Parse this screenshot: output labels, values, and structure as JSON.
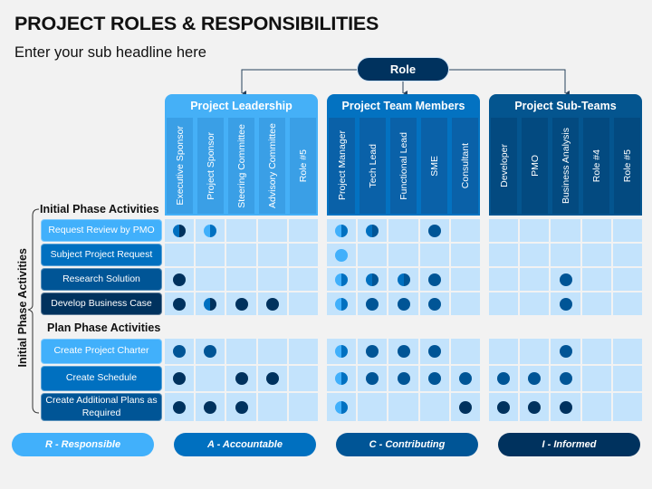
{
  "title": "PROJECT ROLES & RESPONSIBILITIES",
  "subtitle": "Enter your sub headline here",
  "role_label": "Role",
  "side_label": "Initial Phase Activities",
  "colors": {
    "R": "#41b0fb",
    "A": "#0070c0",
    "C": "#005596",
    "I": "#00325e"
  },
  "groups": [
    {
      "name": "Project Leadership",
      "columns": [
        "Executive Sponsor",
        "Project Sponsor",
        "Steering Committee",
        "Advisory Committee",
        "Role #5"
      ]
    },
    {
      "name": "Project Team Members",
      "columns": [
        "Project Manager",
        "Tech Lead",
        "Functional Lead",
        "SME",
        "Consultant"
      ]
    },
    {
      "name": "Project Sub-Teams",
      "columns": [
        "Developer",
        "PMO",
        "Business Analysis",
        "Role #4",
        "Role #5"
      ]
    }
  ],
  "sections": [
    {
      "title": "Initial Phase Activities",
      "rows": [
        {
          "label": "Request Review by PMO",
          "shade": "R",
          "cells": [
            "A/I",
            "R/A",
            "",
            "",
            "",
            "R/A",
            "A/C",
            "",
            "C",
            "",
            "",
            "",
            "",
            "",
            ""
          ]
        },
        {
          "label": "Subject Project Request",
          "shade": "A",
          "cells": [
            "",
            "",
            "",
            "",
            "",
            "R",
            "",
            "",
            "",
            "",
            "",
            "",
            "",
            "",
            ""
          ]
        },
        {
          "label": "Research Solution",
          "shade": "C",
          "cells": [
            "I",
            "",
            "",
            "",
            "",
            "R/A",
            "A/C",
            "A/C",
            "C",
            "",
            "",
            "",
            "C",
            "",
            ""
          ]
        },
        {
          "label": "Develop Business Case",
          "shade": "I",
          "cells": [
            "I",
            "A/I",
            "I",
            "I",
            "",
            "R/A",
            "C",
            "C",
            "C",
            "",
            "",
            "",
            "C",
            "",
            ""
          ]
        }
      ]
    },
    {
      "title": "Plan Phase Activities",
      "rows": [
        {
          "label": "Create Project Charter",
          "shade": "R",
          "cells": [
            "C",
            "C",
            "",
            "",
            "",
            "R/A",
            "C",
            "C",
            "C",
            "",
            "",
            "",
            "C",
            "",
            ""
          ]
        },
        {
          "label": "Create Schedule",
          "shade": "A",
          "cells": [
            "I",
            "",
            "I",
            "I",
            "",
            "R/A",
            "C",
            "C",
            "C",
            "C",
            "C",
            "C",
            "C",
            "",
            ""
          ]
        },
        {
          "label": "Create Additional Plans as Required",
          "shade": "C",
          "cells": [
            "I",
            "I",
            "I",
            "",
            "",
            "R/A",
            "",
            "",
            "",
            "I",
            "I",
            "I",
            "I",
            "",
            ""
          ]
        }
      ]
    }
  ],
  "legend": [
    {
      "key": "R",
      "label": "R - Responsible"
    },
    {
      "key": "A",
      "label": "A - Accountable"
    },
    {
      "key": "C",
      "label": "C - Contributing"
    },
    {
      "key": "I",
      "label": "I - Informed"
    }
  ]
}
